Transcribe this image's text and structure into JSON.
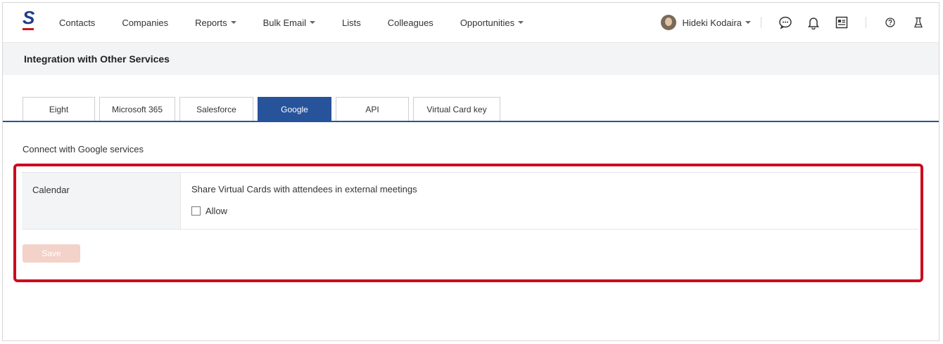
{
  "nav": {
    "items": [
      {
        "label": "Contacts",
        "dropdown": false
      },
      {
        "label": "Companies",
        "dropdown": false
      },
      {
        "label": "Reports",
        "dropdown": true
      },
      {
        "label": "Bulk Email",
        "dropdown": true
      },
      {
        "label": "Lists",
        "dropdown": false
      },
      {
        "label": "Colleagues",
        "dropdown": false
      },
      {
        "label": "Opportunities",
        "dropdown": true
      }
    ],
    "user_name": "Hideki Kodaira",
    "icons": [
      "chat-icon",
      "bell-icon",
      "card-icon",
      "help-icon",
      "lab-flask-icon"
    ]
  },
  "page": {
    "title": "Integration with Other Services"
  },
  "tabs": [
    {
      "label": "Eight",
      "active": false
    },
    {
      "label": "Microsoft 365",
      "active": false
    },
    {
      "label": "Salesforce",
      "active": false
    },
    {
      "label": "Google",
      "active": true
    },
    {
      "label": "API",
      "active": false
    },
    {
      "label": "Virtual Card key",
      "active": false
    }
  ],
  "section": {
    "label": "Connect with Google services"
  },
  "settings": {
    "row_label": "Calendar",
    "description": "Share Virtual Cards with attendees in external meetings",
    "checkbox_label": "Allow",
    "checkbox_checked": false
  },
  "actions": {
    "save_label": "Save"
  },
  "colors": {
    "accent": "#27539b",
    "highlight": "#cc0a1f",
    "save_disabled": "#f3d2c9"
  }
}
